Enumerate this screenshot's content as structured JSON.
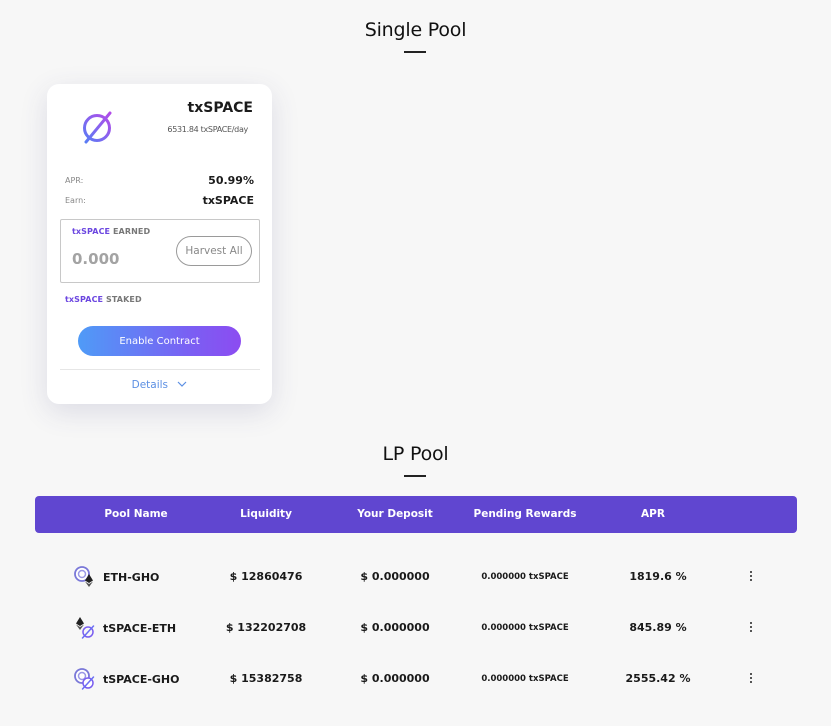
{
  "single_pool": {
    "title": "Single Pool",
    "card": {
      "token_name": "txSPACE",
      "rate": "6531.84 txSPACE/day",
      "apr_label": "APR:",
      "apr_value": "50.99%",
      "earn_label": "Earn:",
      "earn_value": "txSPACE",
      "earned_token": "txSPACE",
      "earned_suffix": " EARNED",
      "earned_amount": "0.000",
      "harvest_label": "Harvest All",
      "staked_token": "txSPACE",
      "staked_suffix": " STAKED",
      "enable_label": "Enable Contract",
      "details_label": "Details"
    }
  },
  "lp_pool": {
    "title": "LP Pool",
    "columns": [
      "Pool Name",
      "Liquidity",
      "Your Deposit",
      "Pending Rewards",
      "APR"
    ],
    "rows": [
      {
        "name": "ETH-GHO",
        "liquidity": "$ 12860476",
        "deposit": "$ 0.000000",
        "rewards": "0.000000 txSPACE",
        "apr": "1819.6 %",
        "icons": [
          "gho-icon",
          "eth-icon"
        ]
      },
      {
        "name": "tSPACE-ETH",
        "liquidity": "$ 132202708",
        "deposit": "$ 0.000000",
        "rewards": "0.000000 txSPACE",
        "apr": "845.89 %",
        "icons": [
          "eth-icon",
          "space-icon"
        ]
      },
      {
        "name": "tSPACE-GHO",
        "liquidity": "$ 15382758",
        "deposit": "$ 0.000000",
        "rewards": "0.000000 txSPACE",
        "apr": "2555.42 %",
        "icons": [
          "gho-icon",
          "space-icon"
        ]
      }
    ]
  },
  "colors": {
    "accent": "#6046d0",
    "button_gradient_start": "#4f9bf7",
    "button_gradient_end": "#8c4cf1",
    "link": "#5b8fe3"
  }
}
